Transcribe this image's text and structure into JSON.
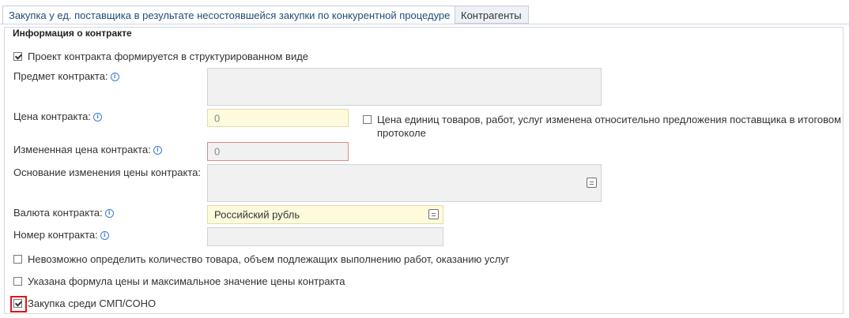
{
  "tabs": [
    {
      "label": "Закупка у ед. поставщика в результате несостоявшейся закупки по конкурентной процедуре",
      "active": true
    },
    {
      "label": "Контрагенты",
      "active": false
    }
  ],
  "section": {
    "title": "Информация о контракте"
  },
  "structured_checkbox": {
    "label": "Проект контракта формируется в структурированном виде",
    "checked": true
  },
  "subject": {
    "label": "Предмет контракта:",
    "value": ""
  },
  "price": {
    "label": "Цена контракта:",
    "value": "0"
  },
  "price_changed_checkbox": {
    "label_line1": "Цена единиц товаров, работ, услуг изменена относительно предложения поставщика в итоговом",
    "label_line2": "протоколе",
    "checked": false
  },
  "changed_price": {
    "label": "Измененная цена контракта:",
    "value": "0"
  },
  "change_reason": {
    "label": "Основание изменения цены контракта:",
    "value": ""
  },
  "currency": {
    "label": "Валюта контракта:",
    "value": "Российский рубль"
  },
  "contract_number": {
    "label": "Номер контракта:",
    "value": ""
  },
  "quantity_checkbox": {
    "label": "Невозможно определить количество товара, объем подлежащих выполнению работ, оказанию услуг",
    "checked": false
  },
  "formula_checkbox": {
    "label": "Указана формула цены и максимальное значение цены контракта",
    "checked": false
  },
  "smp_checkbox": {
    "label": "Закупка среди СМП/СОНО",
    "checked": true
  },
  "icons": {
    "info": "info-icon",
    "lookup": "lookup-list-icon",
    "checkmark": "checkmark-icon"
  },
  "colors": {
    "required_field": "#fdfbdc",
    "error_border": "#e18a8a",
    "highlight": "#e0151b",
    "link_tab": "#1f4d7a"
  }
}
